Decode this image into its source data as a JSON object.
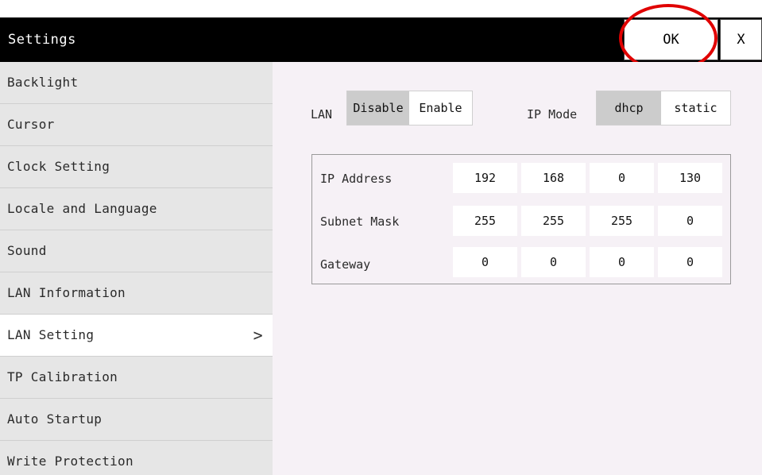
{
  "window": {
    "title": "Settings",
    "ok_label": "OK",
    "close_label": "X"
  },
  "sidebar": {
    "items": [
      {
        "label": "Backlight"
      },
      {
        "label": "Cursor"
      },
      {
        "label": "Clock Setting"
      },
      {
        "label": "Locale and Language"
      },
      {
        "label": "Sound"
      },
      {
        "label": "LAN Information"
      },
      {
        "label": "LAN Setting",
        "active": true,
        "chevron": ">"
      },
      {
        "label": "TP Calibration"
      },
      {
        "label": "Auto Startup"
      },
      {
        "label": "Write Protection"
      }
    ]
  },
  "lan": {
    "label": "LAN",
    "disable_label": "Disable",
    "enable_label": "Enable",
    "selected": "Disable"
  },
  "ip_mode": {
    "label": "IP Mode",
    "dhcp_label": "dhcp",
    "static_label": "static",
    "selected": "dhcp"
  },
  "network": {
    "ip_address": {
      "label": "IP Address",
      "octets": [
        "192",
        "168",
        "0",
        "130"
      ]
    },
    "subnet_mask": {
      "label": "Subnet Mask",
      "octets": [
        "255",
        "255",
        "255",
        "0"
      ]
    },
    "gateway": {
      "label": "Gateway",
      "octets": [
        "0",
        "0",
        "0",
        "0"
      ]
    }
  },
  "colors": {
    "titlebar": "#000000",
    "sidebar_bg": "#e6e6e6",
    "content_bg": "#f6f1f6",
    "selected_segment": "#cccccc",
    "highlight_circle": "#e00000"
  }
}
